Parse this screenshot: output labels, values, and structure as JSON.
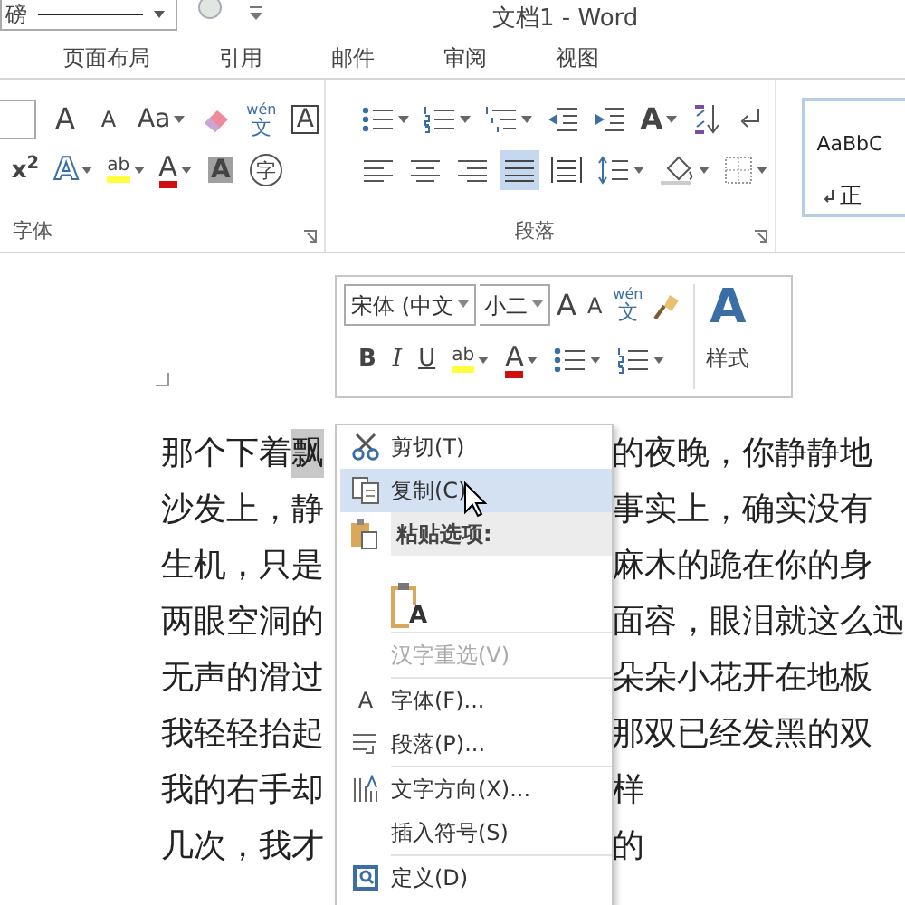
{
  "title_bar": {
    "line_weight": "磅",
    "title": "文档1 - Word"
  },
  "tabs": [
    {
      "label": "页面布局"
    },
    {
      "label": "引用"
    },
    {
      "label": "邮件"
    },
    {
      "label": "审阅"
    },
    {
      "label": "视图"
    }
  ],
  "ribbon": {
    "font_group": {
      "label": "字体",
      "rows": [
        [
          {
            "kind": "field"
          },
          {
            "kind": "grow",
            "glyph": "A"
          },
          {
            "kind": "shrink",
            "glyph": "A"
          },
          {
            "kind": "case",
            "glyph": "Aa",
            "dropdown": true
          },
          {
            "kind": "eraser"
          },
          {
            "kind": "phonetic",
            "glyph": "wén",
            "sub": "文"
          },
          {
            "kind": "boxed",
            "glyph": "A"
          }
        ],
        [
          {
            "kind": "super",
            "glyph": "x$^{2}$"
          },
          {
            "kind": "effect",
            "glyph": "A",
            "dropdown": true
          },
          {
            "kind": "highlight",
            "glyph": "ab",
            "dropdown": true
          },
          {
            "kind": "fontcolor",
            "glyph": "A",
            "dropdown": true
          },
          {
            "kind": "shade",
            "glyph": "A"
          },
          {
            "kind": "enclose",
            "glyph": "字"
          }
        ]
      ]
    },
    "paragraph_group": {
      "label": "段落",
      "rows": [
        [
          {
            "kind": "bullets",
            "dropdown": true
          },
          {
            "kind": "numbering",
            "dropdown": true
          },
          {
            "kind": "multilevel",
            "dropdown": true
          },
          {
            "kind": "outdent"
          },
          {
            "kind": "indent"
          },
          {
            "kind": "asian",
            "glyph": "A",
            "dropdown": true
          },
          {
            "kind": "sort"
          },
          {
            "kind": "marks"
          }
        ],
        [
          {
            "kind": "left",
            "selected": false
          },
          {
            "kind": "center",
            "selected": false
          },
          {
            "kind": "right",
            "selected": false
          },
          {
            "kind": "justify",
            "selected": true
          },
          {
            "kind": "distribute",
            "selected": false
          },
          {
            "kind": "spacing",
            "dropdown": true
          },
          {
            "kind": "fill",
            "dropdown": true
          },
          {
            "kind": "borders",
            "dropdown": true
          }
        ]
      ]
    },
    "styles": {
      "sample": "AaBbC",
      "name": "正"
    }
  },
  "mini_toolbar": {
    "font": "宋体 (中文",
    "size": "小二",
    "row1": [
      {
        "kind": "grow",
        "glyph": "A"
      },
      {
        "kind": "shrink",
        "glyph": "A"
      },
      {
        "kind": "phonetic",
        "glyph": "wén",
        "sub": "文"
      },
      {
        "kind": "painter"
      }
    ],
    "row2": [
      {
        "kind": "bold",
        "glyph": "B"
      },
      {
        "kind": "italic",
        "glyph": "I"
      },
      {
        "kind": "underline",
        "glyph": "U"
      },
      {
        "kind": "highlight",
        "glyph": "ab",
        "dropdown": true
      },
      {
        "kind": "fontcolor",
        "glyph": "A",
        "dropdown": true
      },
      {
        "kind": "bullets",
        "dropdown": true
      },
      {
        "kind": "numbering",
        "dropdown": true
      }
    ],
    "styles_glyph": "A",
    "styles_label": "样式"
  },
  "document": {
    "lines": [
      {
        "left": "那个下着",
        "selection": "飘",
        "right": "的夜晚，你静静地"
      },
      {
        "left": "沙发上，静",
        "right": "事实上，确实没有"
      },
      {
        "left": "生机，只是",
        "right": "麻木的跪在你的身"
      },
      {
        "left": "两眼空洞的",
        "right": "面容，眼泪就这么迅"
      },
      {
        "left": "无声的滑过",
        "right": "朵朵小花开在地板"
      },
      {
        "left": "我轻轻抬起",
        "right": "那双已经发黑的双"
      },
      {
        "left": "我的右手却",
        "right": "样"
      },
      {
        "left": "几次，我才",
        "right": "的"
      }
    ]
  },
  "context_menu": {
    "items": [
      {
        "kind": "cut",
        "label": "剪切(T)",
        "selected": false,
        "disabled": false
      },
      {
        "kind": "copy",
        "label": "复制(C)",
        "selected": true,
        "disabled": false
      },
      {
        "kind": "header",
        "label": "粘贴选项:"
      },
      {
        "kind": "paste",
        "glyph": "A"
      },
      {
        "kind": "plain",
        "label": "汉字重选(V)",
        "selected": false,
        "disabled": true
      },
      {
        "kind": "font",
        "glyph": "A",
        "label": "字体(F)...",
        "selected": false,
        "disabled": false
      },
      {
        "kind": "paragraph",
        "label": "段落(P)...",
        "selected": false,
        "disabled": false
      },
      {
        "kind": "direction",
        "label": "文字方向(X)...",
        "selected": false,
        "disabled": false
      },
      {
        "kind": "plain",
        "label": "插入符号(S)",
        "selected": false,
        "disabled": false
      },
      {
        "kind": "define",
        "label": "定义(D)",
        "selected": false,
        "disabled": false
      }
    ]
  }
}
